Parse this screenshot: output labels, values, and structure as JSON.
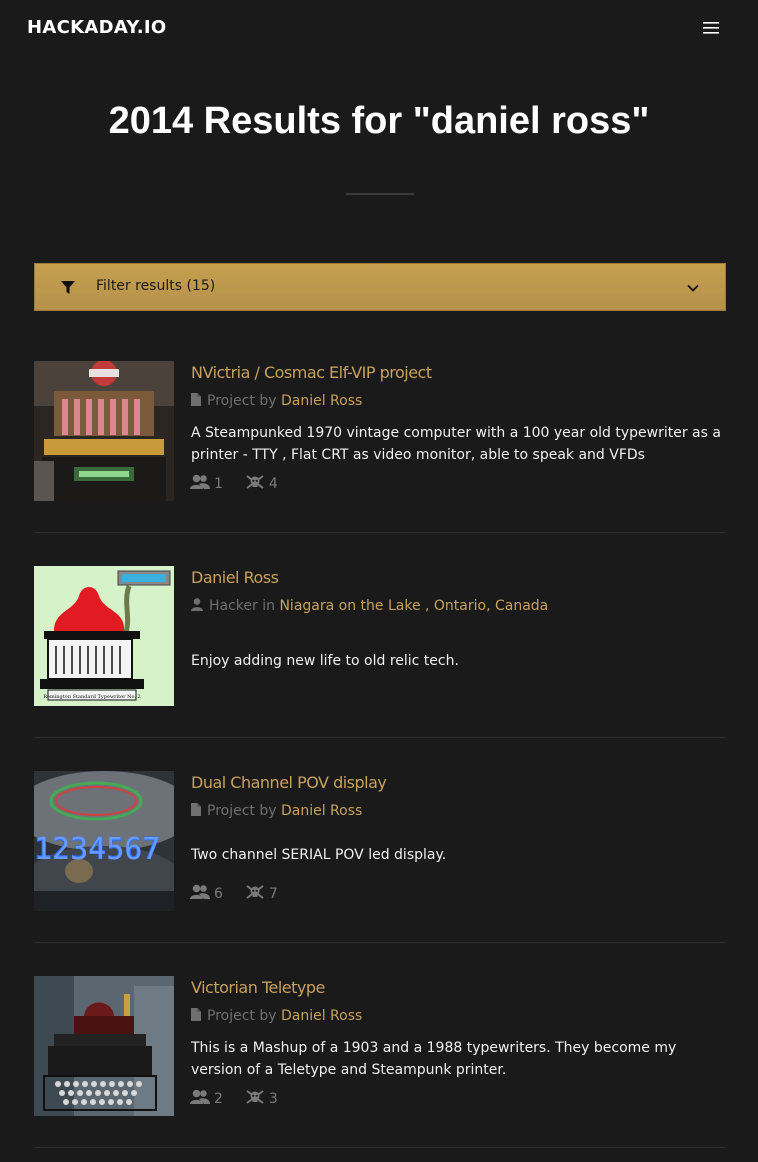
{
  "header": {
    "logo": "HACKADAY.IO",
    "menu_icon": "hamburger-menu-icon"
  },
  "page": {
    "title": "2014 Results for \"daniel ross\""
  },
  "filter": {
    "icon": "funnel-icon",
    "label": "Filter results (15)",
    "chevron_icon": "chevron-down-icon"
  },
  "results": [
    {
      "title": "NVictria / Cosmac Elf-VIP project",
      "kind": "Project by",
      "link": "Daniel Ross",
      "description": "A Steampunked 1970 vintage computer with a 100 year old typewriter as a printer - TTY , Flat CRT as video monitor, able to speak and VFDs",
      "members": "1",
      "skulls": "4"
    },
    {
      "title": "Daniel Ross",
      "kind": "Hacker in",
      "link": "Niagara on the Lake , Ontario, Canada",
      "description": "Enjoy adding new life to old relic tech."
    },
    {
      "title": "Dual Channel POV display",
      "kind": "Project by",
      "link": "Daniel Ross",
      "description": "Two channel SERIAL POV led display.",
      "members": "6",
      "skulls": "7"
    },
    {
      "title": "Victorian Teletype",
      "kind": "Project by",
      "link": "Daniel Ross",
      "description": "This is a Mashup of a 1903 and a 1988 typewriters. They become my version of a Teletype and Steampunk printer.",
      "members": "2",
      "skulls": "3"
    }
  ],
  "colors": {
    "background": "#1a1a1a",
    "accent_gold": "#c8a15a",
    "filter_bar": "#c0994d",
    "muted_text": "#6f6f6f"
  }
}
